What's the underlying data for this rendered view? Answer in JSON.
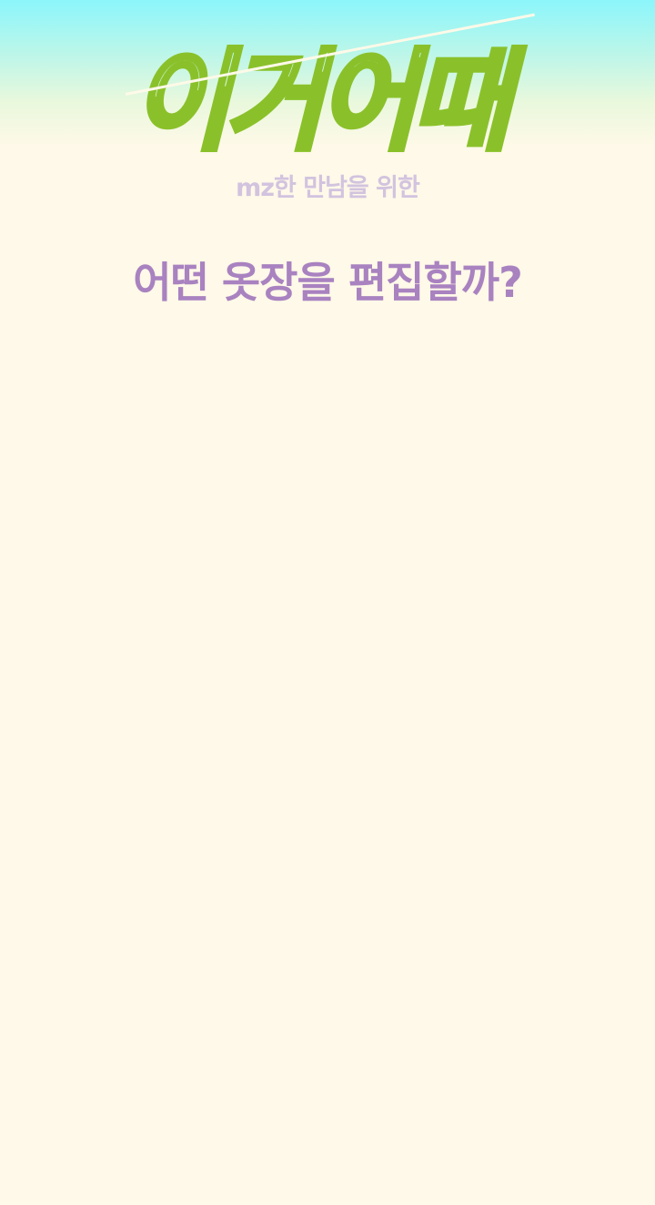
{
  "header": {
    "logo_text": "이거어때",
    "tagline": "mz한 만남을 위한"
  },
  "main": {
    "question": "어떤 옷장을 편집할까?"
  },
  "colors": {
    "background": "#fef9e8",
    "gradient_top": "#8cf6fb",
    "logo_green": "#8ac12a",
    "tagline_lilac": "#d2c3df",
    "question_purple": "#a982c0"
  }
}
